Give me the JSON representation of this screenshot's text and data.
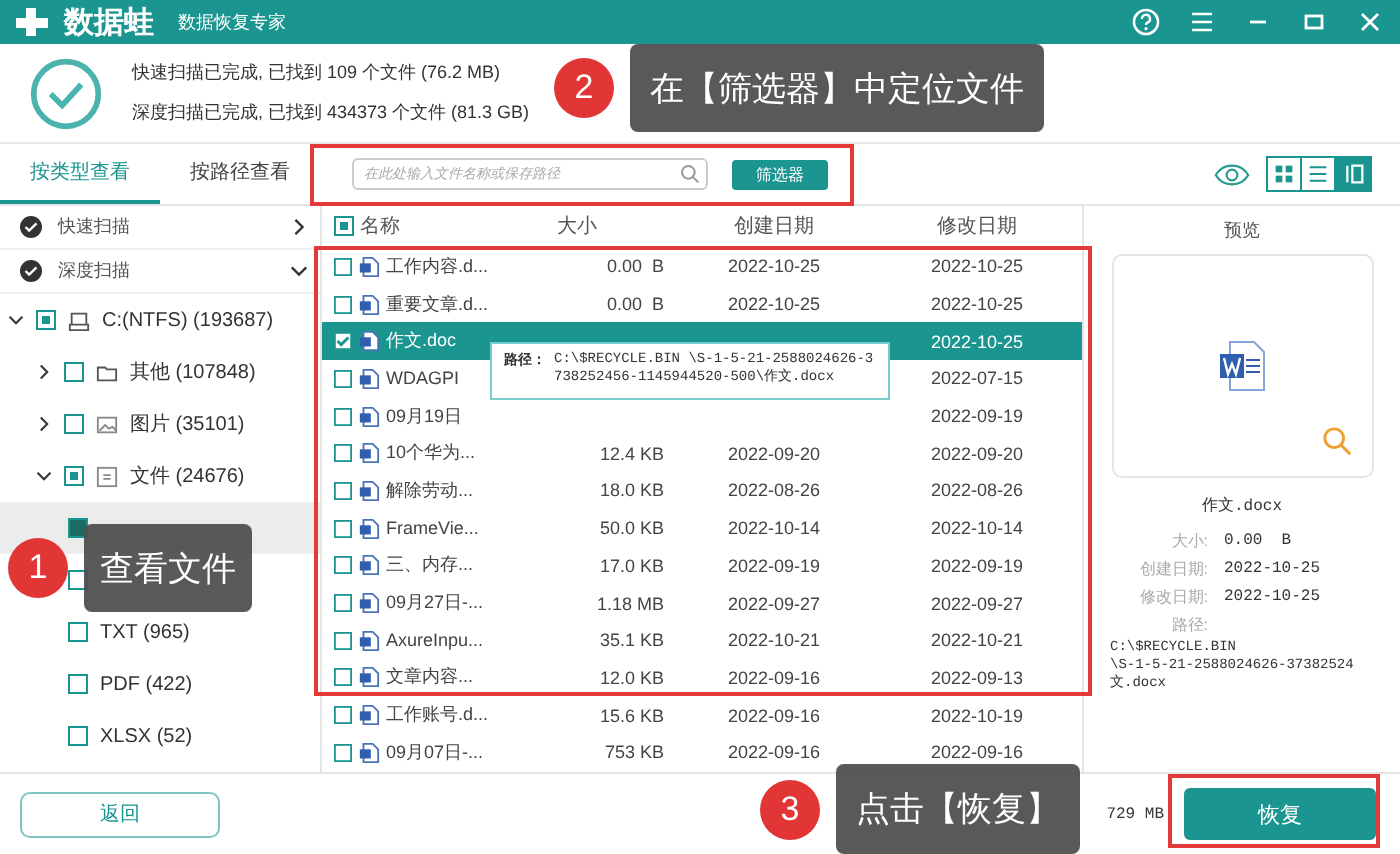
{
  "app": {
    "name": "数据蛙",
    "subtitle": "数据恢复专家"
  },
  "scan_summary": [
    "快速扫描已完成, 已找到 109 个文件 (76.2 MB)",
    "深度扫描已完成, 已找到 434373 个文件 (81.3 GB)"
  ],
  "view_tabs": [
    {
      "label": "按类型查看",
      "selected": true
    },
    {
      "label": "按路径查看",
      "selected": false
    }
  ],
  "search": {
    "placeholder": "在此处输入文件名称或保存路径"
  },
  "filter_button": "筛选器",
  "view_modes": [
    {
      "kind": "grid",
      "selected": false
    },
    {
      "kind": "list",
      "selected": false
    },
    {
      "kind": "detail",
      "selected": true
    }
  ],
  "scans": [
    {
      "label": "快速扫描",
      "expanded": false
    },
    {
      "label": "深度扫描",
      "expanded": true,
      "children": [
        {
          "label": "C:(NTFS) (193687)",
          "kind": "drive",
          "partial": true,
          "expanded": true,
          "children": [
            {
              "label": "其他 (107848)",
              "kind": "folder",
              "partial": false,
              "expanded": false
            },
            {
              "label": "图片 (35101)",
              "kind": "image",
              "partial": false,
              "expanded": false
            },
            {
              "label": "文件 (24676)",
              "kind": "document",
              "partial": true,
              "expanded": true,
              "children": [
                {
                  "checked": true,
                  "selected": true
                },
                {
                  "checked": false,
                  "selected": false
                },
                {
                  "label": "TXT (965)",
                  "checked": false,
                  "selected": false
                },
                {
                  "label": "PDF (422)",
                  "checked": false,
                  "selected": false
                },
                {
                  "label": "XLSX (52)",
                  "checked": false,
                  "selected": false
                }
              ]
            }
          ]
        }
      ]
    }
  ],
  "table": {
    "columns": [
      "名称",
      "大小",
      "创建日期",
      "修改日期"
    ],
    "header_checkbox": {
      "partial": true
    },
    "rows": [
      {
        "name": "工作内容.d...",
        "size": "0.00  B",
        "created": "2022-10-25",
        "modified": "2022-10-25",
        "checked": false,
        "selected": false
      },
      {
        "name": "重要文章.d...",
        "size": "0.00  B",
        "created": "2022-10-25",
        "modified": "2022-10-25",
        "checked": false,
        "selected": false
      },
      {
        "name": "作文.doc",
        "modified": "2022-10-25",
        "checked": true,
        "selected": true
      },
      {
        "name": "WDAGPI",
        "modified": "2022-07-15",
        "checked": false,
        "selected": false
      },
      {
        "name": "09月19日",
        "modified": "2022-09-19",
        "checked": false,
        "selected": false
      },
      {
        "name": "10个华为...",
        "size": "12.4 KB",
        "created": "2022-09-20",
        "modified": "2022-09-20",
        "checked": false,
        "selected": false
      },
      {
        "name": "解除劳动...",
        "size": "18.0 KB",
        "created": "2022-08-26",
        "modified": "2022-08-26",
        "checked": false,
        "selected": false
      },
      {
        "name": "FrameVie...",
        "size": "50.0 KB",
        "created": "2022-10-14",
        "modified": "2022-10-14",
        "checked": false,
        "selected": false
      },
      {
        "name": "三、内存...",
        "size": "17.0 KB",
        "created": "2022-09-19",
        "modified": "2022-09-19",
        "checked": false,
        "selected": false
      },
      {
        "name": "09月27日-...",
        "size": "1.18 MB",
        "created": "2022-09-27",
        "modified": "2022-09-27",
        "checked": false,
        "selected": false
      },
      {
        "name": "AxureInpu...",
        "size": "35.1 KB",
        "created": "2022-10-21",
        "modified": "2022-10-21",
        "checked": false,
        "selected": false
      },
      {
        "name": "文章内容...",
        "size": "12.0 KB",
        "created": "2022-09-16",
        "modified": "2022-09-13",
        "checked": false,
        "selected": false
      },
      {
        "name": "工作账号.d...",
        "size": "15.6 KB",
        "created": "2022-09-16",
        "modified": "2022-10-19",
        "checked": false,
        "selected": false
      },
      {
        "name": "09月07日-...",
        "size": "753 KB",
        "created": "2022-09-16",
        "modified": "2022-09-16",
        "checked": false,
        "selected": false
      }
    ]
  },
  "path_tooltip": {
    "label": "路径：",
    "text": "C:\\$RECYCLE.BIN \\S-1-5-21-2588024626-3738252456-1145944520-500\\作文.docx"
  },
  "preview": {
    "title": "预览",
    "file_name": "作文.docx",
    "fields": [
      {
        "label": "大小:",
        "value": "0.00  B"
      },
      {
        "label": "创建日期:",
        "value": "2022-10-25"
      },
      {
        "label": "修改日期:",
        "value": "2022-10-25"
      }
    ],
    "path_label": "路径:",
    "path_lines": [
      "C:\\$RECYCLE.BIN",
      "\\S-1-5-21-2588024626-37382524",
      "文.docx"
    ]
  },
  "back_button": "返回",
  "selection_info": "729 MB",
  "recover_button": "恢复",
  "callouts": [
    {
      "number": "1",
      "text": "查看文件"
    },
    {
      "number": "2",
      "text": "在【筛选器】中定位文件"
    },
    {
      "number": "3",
      "text": "点击【恢复】"
    }
  ]
}
